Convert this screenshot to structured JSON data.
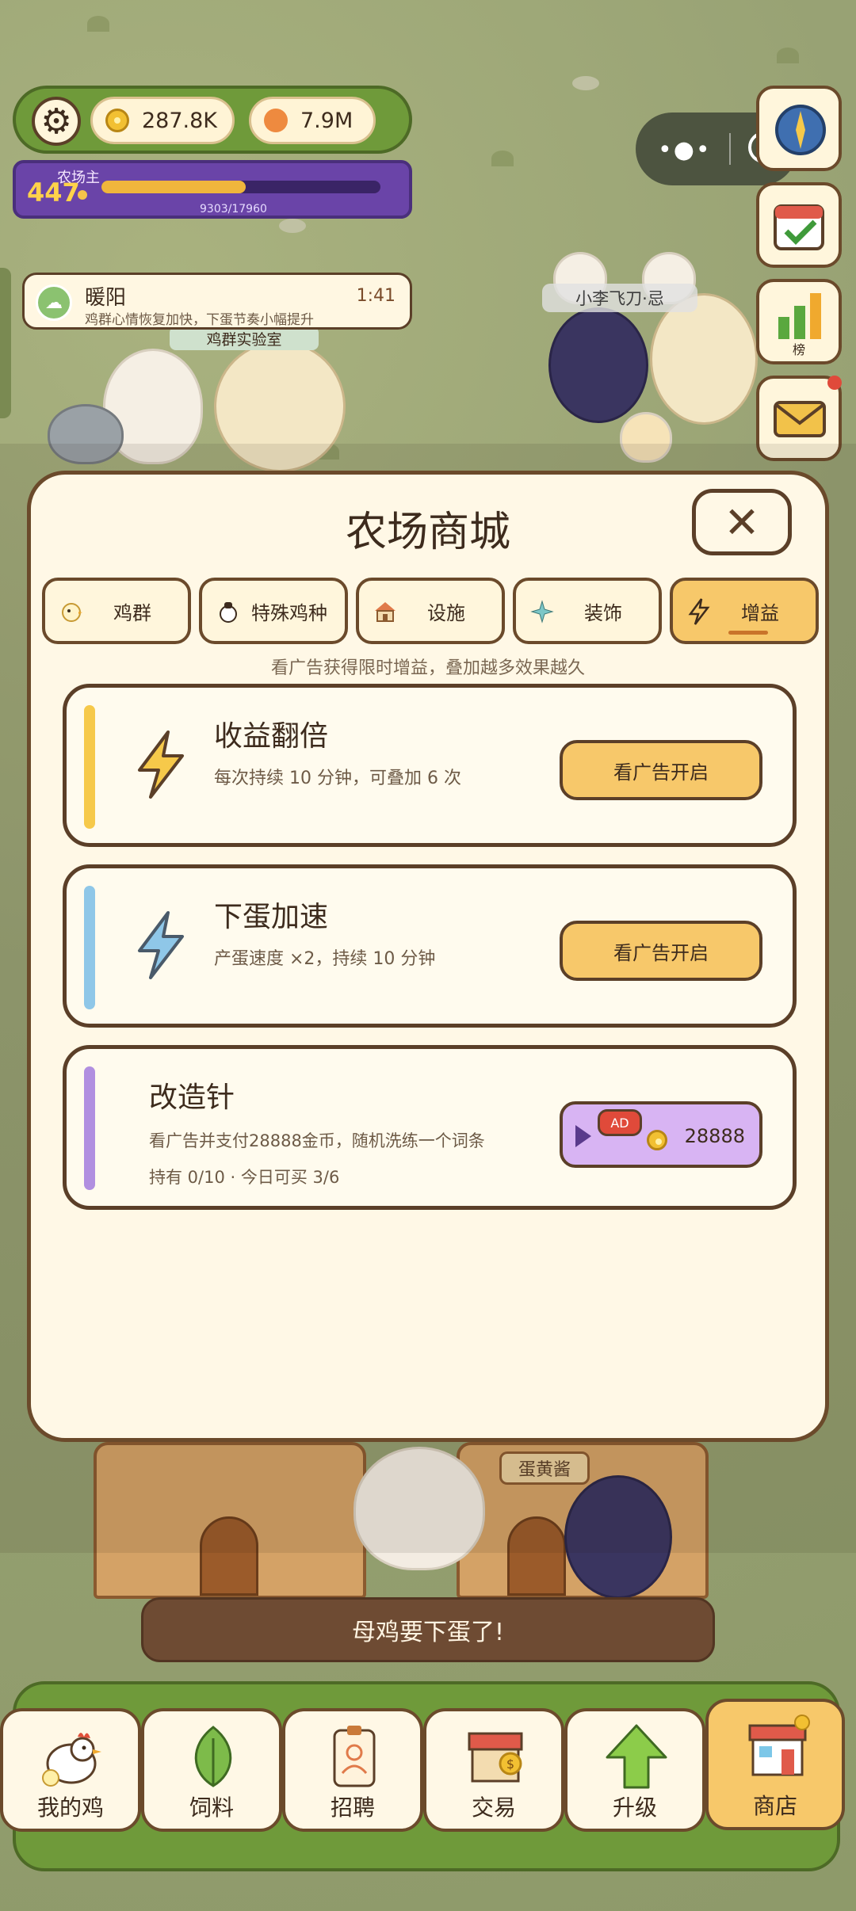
{
  "hud": {
    "gold": "287.8K",
    "gems": "7.9M",
    "level": "447",
    "level_title": "农场主",
    "xp_text": "9303/17960",
    "xp_progress": 0.518
  },
  "notice": {
    "title": "暖阳",
    "subtitle": "鸡群心情恢复加快，下蛋节奏小幅提升",
    "time": "1:41"
  },
  "world_labels": {
    "lab": "鸡群实验室",
    "player": "小李飞刀·忌",
    "house_sign": "蛋黄酱"
  },
  "side": {
    "rank_label": "榜"
  },
  "shop": {
    "title": "农场商城",
    "hint": "看广告获得限时增益，叠加越多效果越久",
    "tabs": [
      {
        "label": "鸡群"
      },
      {
        "label": "特殊鸡种"
      },
      {
        "label": "设施"
      },
      {
        "label": "装饰"
      },
      {
        "label": "增益"
      }
    ],
    "items": [
      {
        "title": "收益翻倍",
        "desc": "每次持续 10 分钟，可叠加 6 次",
        "button": "看广告开启",
        "color": "#f6c94a"
      },
      {
        "title": "下蛋加速",
        "desc": "产蛋速度 ×2，持续 10 分钟",
        "button": "看广告开启",
        "color": "#8fc7e8"
      },
      {
        "title": "改造针",
        "desc": "看广告并支付28888金币，随机洗练一个词条",
        "meta": "持有 0/10 · 今日可买 3/6",
        "ad_tag": "AD",
        "price": "28888",
        "color": "#b18fe0"
      }
    ]
  },
  "toast": "母鸡要下蛋了!",
  "nav": [
    {
      "label": "我的鸡"
    },
    {
      "label": "饲料"
    },
    {
      "label": "招聘"
    },
    {
      "label": "交易"
    },
    {
      "label": "升级"
    },
    {
      "label": "商店"
    }
  ]
}
